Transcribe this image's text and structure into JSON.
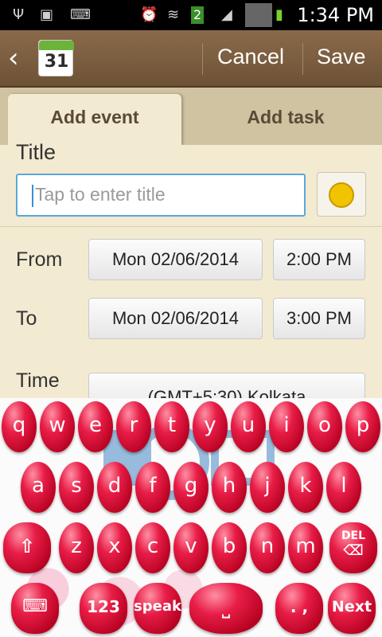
{
  "status_bar": {
    "time": "1:34 PM",
    "icons": [
      "usb-icon",
      "image-icon",
      "keyboard-icon",
      "alarm-icon",
      "wifi-icon",
      "sim2-icon",
      "signal-icon",
      "signal-icon",
      "battery-charging-icon"
    ],
    "sim_badge": "2"
  },
  "action_bar": {
    "calendar_day": "31",
    "cancel_label": "Cancel",
    "save_label": "Save"
  },
  "tabs": [
    {
      "label": "Add event",
      "active": true
    },
    {
      "label": "Add task",
      "active": false
    }
  ],
  "form": {
    "title_label": "Title",
    "title_placeholder": "Tap to enter title",
    "from_label": "From",
    "from_date": "Mon 02/06/2014",
    "from_time": "2:00 PM",
    "to_label": "To",
    "to_date": "Mon 02/06/2014",
    "to_time": "3:00 PM",
    "timezone_label": "Time",
    "timezone_value": "(GMT+5:30) Kolkata"
  },
  "keyboard": {
    "row1": [
      "q",
      "w",
      "e",
      "r",
      "t",
      "y",
      "u",
      "i",
      "o",
      "p"
    ],
    "row2": [
      "a",
      "s",
      "d",
      "f",
      "g",
      "h",
      "j",
      "k",
      "l"
    ],
    "row3": [
      "z",
      "x",
      "c",
      "v",
      "b",
      "n",
      "m"
    ],
    "shift_icon": "shift-icon",
    "delete_label": "DEL",
    "settings_icon": "keyboard-settings-icon",
    "numbers_label": "123",
    "speak_label": "speak",
    "space_icon": "space-icon",
    "punct_label": ". ,",
    "next_label": "Next",
    "accent_color": "#e81d47"
  }
}
